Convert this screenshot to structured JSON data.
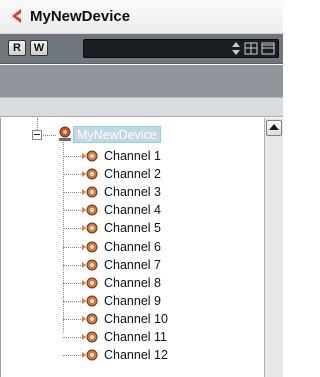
{
  "window": {
    "title": "MyNewDevice"
  },
  "toolbar": {
    "read_button": "R",
    "write_button": "W"
  },
  "tree": {
    "root_label": "MyNewDevice",
    "channels": [
      "Channel 1",
      "Channel 2",
      "Channel 3",
      "Channel 4",
      "Channel 5",
      "Channel 6",
      "Channel 7",
      "Channel 8",
      "Channel 9",
      "Channel 10",
      "Channel 11",
      "Channel 12"
    ]
  },
  "icons": {
    "title": "back-arrow-icon",
    "stepper": "up-down-stepper-icon",
    "add": "add-node-icon",
    "remove": "remove-node-icon",
    "device": "device-node-icon",
    "channel": "channel-node-icon",
    "scroll": "scroll-up-arrow-icon"
  },
  "colors": {
    "toolbar_bg": "#6f767d",
    "dark_field": "#1b1d20",
    "device_icon": "#c7532a",
    "channel_icon": "#d57a3a",
    "selection_border": "#89d7e3",
    "selection_fill": "#c4d6e6",
    "title_arrow": "#e03a24"
  }
}
